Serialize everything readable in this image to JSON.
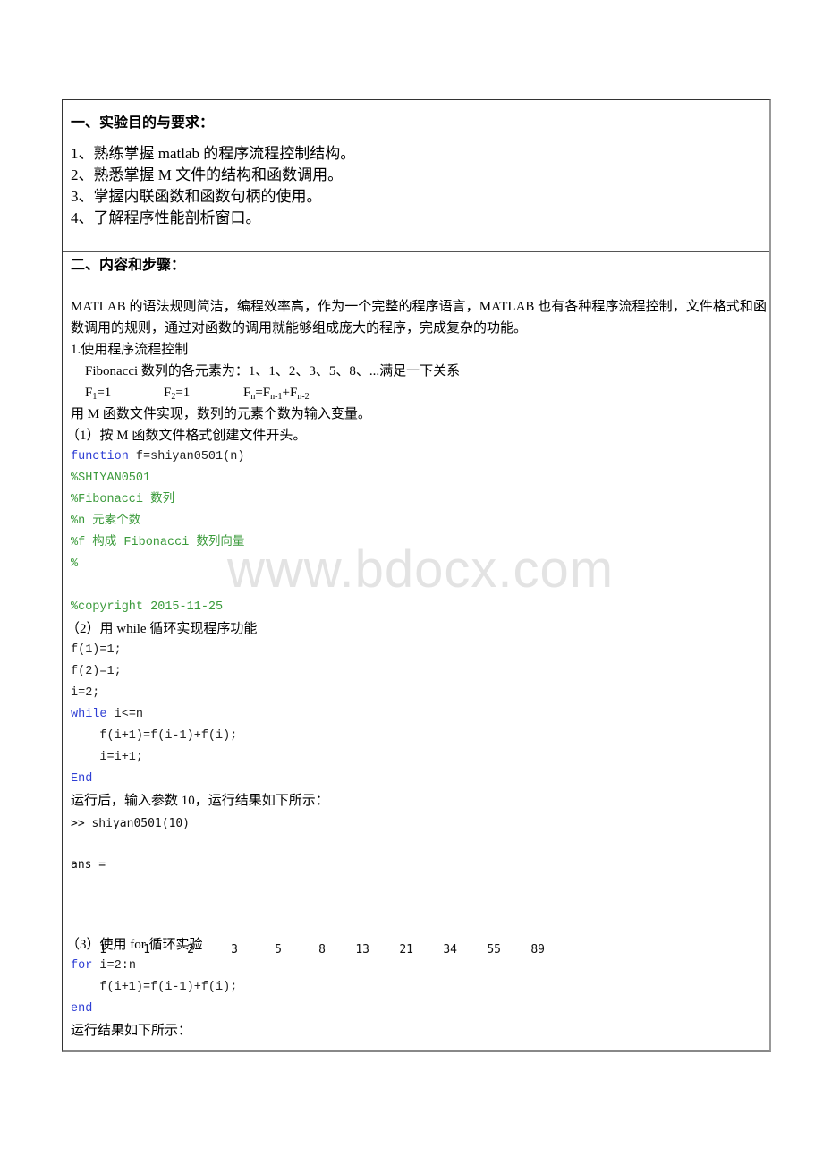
{
  "section1": {
    "heading": "一、实验目的与要求：",
    "goals": [
      "1、熟练掌握 matlab 的程序流程控制结构。",
      "2、熟悉掌握 M 文件的结构和函数调用。",
      "3、掌握内联函数和函数句柄的使用。",
      "4、了解程序性能剖析窗口。"
    ]
  },
  "section2": {
    "heading": "二、内容和步骤：",
    "intro": "MATLAB 的语法规则简洁，编程效率高，作为一个完整的程序语言，MATLAB 也有各种程序流程控制，文件格式和函数调用的规则，通过对函数的调用就能够组成庞大的程序，完成复杂的功能。",
    "step1_title": "1.使用程序流程控制",
    "fib_desc": "Fibonacci 数列的各元素为：1、1、2、3、5、8、...满足一下关系",
    "formula": {
      "f1_main": "F",
      "f1_sub": "1",
      "f1_val": "=1",
      "f2_main": "F",
      "f2_sub": "2",
      "f2_val": "=1",
      "fn_main": "F",
      "fn_sub": "n",
      "fn_eq": "=F",
      "fn_sub1": "n-1",
      "fn_plus": "+F",
      "fn_sub2": "n-2"
    },
    "m_file_desc": "用 M 函数文件实现，数列的元素个数为输入变量。",
    "sub1_title": "（1）按 M 函数文件格式创建文件开头。",
    "header_code": {
      "kw_function": "function",
      "func_sig": " f=shiyan0501(n)",
      "comments": [
        "%SHIYAN0501",
        "%Fibonacci 数列",
        "%n 元素个数",
        "%f 构成 Fibonacci 数列向量",
        "%",
        "",
        "%copyright 2015-11-25"
      ]
    },
    "sub2_title": "（2）用 while 循环实现程序功能",
    "while_code": {
      "l1": "f(1)=1;",
      "l2": "f(2)=1;",
      "l3": "i=2;",
      "kw_while": "while",
      "cond": " i<=n",
      "body1": "    f(i+1)=f(i-1)+f(i);",
      "body2": "    i=i+1;",
      "kw_end": "End"
    },
    "run_desc": "运行后，输入参数 10，运行结果如下所示：",
    "console": {
      "command": ">> shiyan0501(10)",
      "ans_label": "ans =",
      "values": [
        "1",
        "1",
        "2",
        "3",
        "5",
        "8",
        "13",
        "21",
        "34",
        "55",
        "89"
      ]
    },
    "sub3_title": "（3）使用 for 循环实验",
    "for_code": {
      "kw_for": "for",
      "range": " i=2:n",
      "body": "    f(i+1)=f(i-1)+f(i);",
      "kw_end": "end"
    },
    "result_desc": "运行结果如下所示："
  },
  "watermark": "www.bdocx.com"
}
